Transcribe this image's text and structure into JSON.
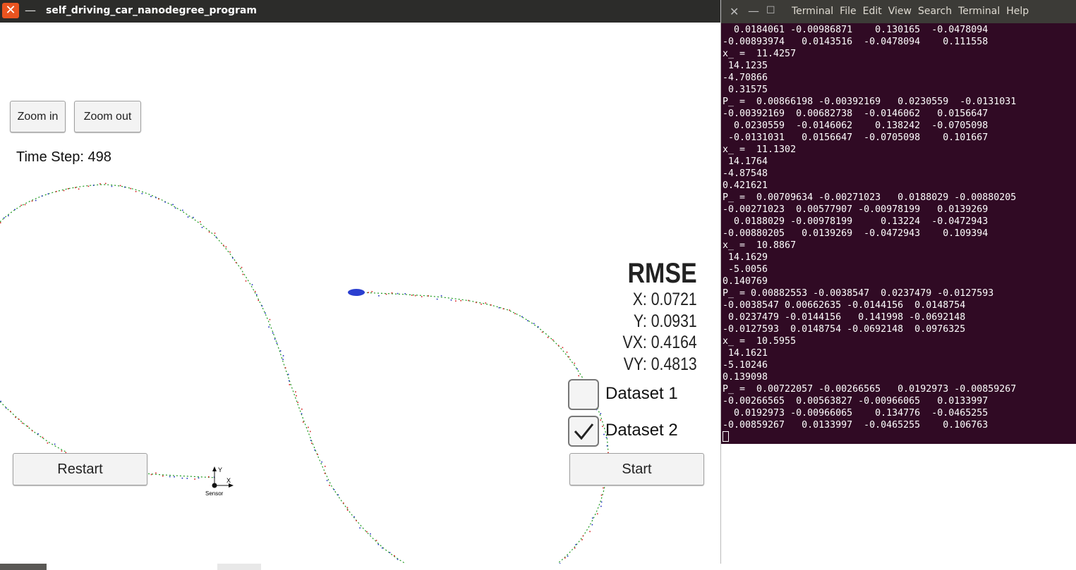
{
  "simulator": {
    "title": "self_driving_car_nanodegree_program",
    "close_glyph": "✕",
    "minimize_glyph": "—",
    "zoom_in_label": "Zoom in",
    "zoom_out_label": "Zoom out",
    "time_step": "Time Step: 498",
    "rmse": {
      "title": "RMSE",
      "x": "X: 0.0721",
      "y": "Y: 0.0931",
      "vx": "VX: 0.4164",
      "vy": "VY: 0.4813"
    },
    "dataset1_label": "Dataset 1",
    "dataset2_label": "Dataset 2",
    "dataset1_checked": false,
    "dataset2_checked": true,
    "restart_label": "Restart",
    "start_label": "Start",
    "sensor": {
      "label": "Sensor",
      "x_axis": "X",
      "y_axis": "Y"
    },
    "colors": {
      "track": "#1f9a1f",
      "laser": "#d42020",
      "radar": "#2030c0",
      "car": "#2b3fd0"
    }
  },
  "terminal": {
    "close_glyph": "✕",
    "minimize_glyph": "—",
    "maximize_glyph": "☐",
    "menu": [
      "Terminal",
      "File",
      "Edit",
      "View",
      "Search",
      "Terminal",
      "Help"
    ],
    "lines": [
      "  0.0184061 -0.00986871    0.130165  -0.0478094",
      "-0.00893974   0.0143516  -0.0478094    0.111558",
      "x_ =  11.4257",
      " 14.1235",
      "-4.70866",
      " 0.31575",
      "P_ =  0.00866198 -0.00392169   0.0230559  -0.0131031",
      "-0.00392169  0.00682738  -0.0146062   0.0156647",
      "  0.0230559  -0.0146062    0.138242  -0.0705098",
      " -0.0131031   0.0156647  -0.0705098    0.101667",
      "x_ =  11.1302",
      " 14.1764",
      "-4.87548",
      "0.421621",
      "P_ =  0.00709634 -0.00271023   0.0188029 -0.00880205",
      "-0.00271023  0.00577907 -0.00978199   0.0139269",
      "  0.0188029 -0.00978199     0.13224  -0.0472943",
      "-0.00880205   0.0139269  -0.0472943    0.109394",
      "x_ =  10.8867",
      " 14.1629",
      " -5.0056",
      "0.140769",
      "P_ = 0.00882553 -0.0038547  0.0237479 -0.0127593",
      "-0.0038547 0.00662635 -0.0144156  0.0148754",
      " 0.0237479 -0.0144156   0.141998 -0.0692148",
      "-0.0127593  0.0148754 -0.0692148  0.0976325",
      "x_ =  10.5955",
      " 14.1621",
      "-5.10246",
      "0.139098",
      "P_ =  0.00722057 -0.00266565   0.0192973 -0.00859267",
      "-0.00266565  0.00563827 -0.00966065   0.0133997",
      "  0.0192973 -0.00966065    0.134776  -0.0465255",
      "-0.00859267   0.0133997  -0.0465255    0.106763"
    ]
  }
}
